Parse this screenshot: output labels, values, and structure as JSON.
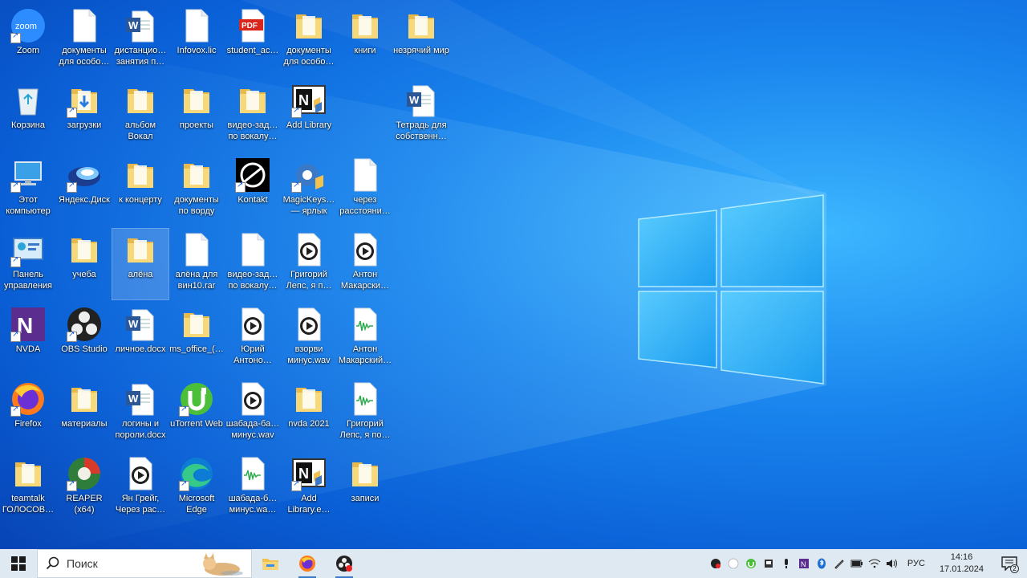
{
  "desktop": {
    "icons": [
      {
        "label": "Zoom",
        "icon": "zoom-app-icon"
      },
      {
        "label": "документы для особо…",
        "icon": "document-icon"
      },
      {
        "label": "дистанцио… занятия п…",
        "icon": "word-document-icon"
      },
      {
        "label": "Infovox.lic",
        "icon": "file-icon"
      },
      {
        "label": "student_ac…",
        "icon": "pdf-icon"
      },
      {
        "label": "документы для особо…",
        "icon": "folder-icon"
      },
      {
        "label": "книги",
        "icon": "folder-icon"
      },
      {
        "label": "незрячий мир",
        "icon": "folder-icon"
      },
      {
        "label": "Корзина",
        "icon": "recycle-bin-icon"
      },
      {
        "label": "загрузки",
        "icon": "downloads-folder-icon"
      },
      {
        "label": "альбом Вокал",
        "icon": "folder-icon"
      },
      {
        "label": "проекты",
        "icon": "folder-icon"
      },
      {
        "label": "видео-зад… по вокалу…",
        "icon": "folder-icon"
      },
      {
        "label": "Add Library",
        "icon": "add-library-icon"
      },
      {
        "label": "Тетрадь для собственн…",
        "icon": "word-document-icon"
      },
      {
        "label": "Этот компьютер",
        "icon": "this-pc-icon"
      },
      {
        "label": "Яндекс.Диск",
        "icon": "yandex-disk-icon"
      },
      {
        "label": "к концерту",
        "icon": "folder-icon"
      },
      {
        "label": "документы по ворду",
        "icon": "folder-icon"
      },
      {
        "label": "Kontakt",
        "icon": "kontakt-icon"
      },
      {
        "label": "MagicKeys… — ярлык",
        "icon": "magickeys-icon"
      },
      {
        "label": "через расстояни…",
        "icon": "file-icon"
      },
      {
        "label": "Панель управления",
        "icon": "control-panel-icon"
      },
      {
        "label": "учеба",
        "icon": "folder-icon"
      },
      {
        "label": "алёна",
        "icon": "folder-icon"
      },
      {
        "label": "алёна для вин10.rar",
        "icon": "file-icon"
      },
      {
        "label": "видео-зад… по вокалу…",
        "icon": "file-icon"
      },
      {
        "label": "Григорий Лепс, я п…",
        "icon": "media-audio-icon"
      },
      {
        "label": "Антон Макарски…",
        "icon": "media-audio-icon"
      },
      {
        "label": "NVDA",
        "icon": "nvda-icon"
      },
      {
        "label": "OBS Studio",
        "icon": "obs-icon"
      },
      {
        "label": "личное.docx",
        "icon": "word-document-icon"
      },
      {
        "label": "ms_office_(…",
        "icon": "folder-icon"
      },
      {
        "label": "Юрий Антоно…",
        "icon": "media-audio-icon"
      },
      {
        "label": "взорви минус.wav",
        "icon": "media-audio-icon"
      },
      {
        "label": "Антон Макарский…",
        "icon": "wave-audio-icon"
      },
      {
        "label": "Firefox",
        "icon": "firefox-icon"
      },
      {
        "label": "материалы",
        "icon": "folder-icon"
      },
      {
        "label": "логины и пороли.docx",
        "icon": "word-document-icon"
      },
      {
        "label": "uTorrent Web",
        "icon": "utorrent-icon"
      },
      {
        "label": "шабада-ба… минус.wav",
        "icon": "media-audio-icon"
      },
      {
        "label": "nvda 2021",
        "icon": "folder-icon"
      },
      {
        "label": "Григорий Лепс, я по…",
        "icon": "wave-audio-icon"
      },
      {
        "label": "teamtalk ГОЛОСОВ…",
        "icon": "folder-icon"
      },
      {
        "label": "REAPER (x64)",
        "icon": "reaper-icon"
      },
      {
        "label": "Ян Грейг, Через рас…",
        "icon": "media-audio-icon"
      },
      {
        "label": "Microsoft Edge",
        "icon": "edge-icon"
      },
      {
        "label": "шабада-б… минус.wa…",
        "icon": "wave-audio-icon"
      },
      {
        "label": "Add Library.e…",
        "icon": "add-library-exe-icon"
      },
      {
        "label": "записи",
        "icon": "folder-icon"
      }
    ]
  },
  "taskbar": {
    "search_placeholder": "Поиск",
    "apps": [
      "file-explorer-icon",
      "firefox-icon",
      "obs-icon"
    ],
    "tray": {
      "language": "РУС",
      "time": "14:16",
      "date": "17.01.2024",
      "notification_count": "2"
    }
  },
  "colors": {
    "taskbar_bg": "#dfe9f1",
    "folder_yellow": "#f5d67a",
    "word_blue": "#2b5797"
  }
}
